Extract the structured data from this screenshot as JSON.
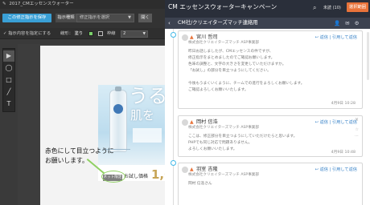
{
  "left": {
    "window_title": "2017_CMエッセンスウォーター",
    "save_button": "この修正指示を保存",
    "direction_label": "指示種類",
    "direction_placeholder": "修正指示を選択",
    "pull_button": "開く",
    "show_instructions": "指示内容を指定にする",
    "line_label": "線形：",
    "line_value": "塗り",
    "border_label": "枠線",
    "border_value": "2",
    "tools": [
      "▶",
      "◯",
      "□",
      "╱",
      "T"
    ],
    "annotation_text_1": "赤色にして目立つように",
    "annotation_text_2": "お願いします。",
    "ad": {
      "headline_1": "うる",
      "headline_2": "肌を",
      "badge": "ネット限定",
      "price_label": "お試し価格",
      "price_value": "1,0"
    }
  },
  "right": {
    "title": "CM エッセンスウォーターキャンペーン",
    "search_icon": "search-icon",
    "status": "未読 (10)",
    "select_button": "選択範囲",
    "sub_title": "CM社/クリエイターズマッチ連絡用",
    "sub_icons": "👤 ✉ ⚙",
    "messages": [
      {
        "name": "宮川 哲司",
        "company": "株式会社クリエイターズマッチ ASP事業部",
        "actions": "↩ 返信 | 引用して返信",
        "body": "昨日お話しましたが、CMエッセンスの件ですが、\n修正指示をまとめましたのでご確認お願いします。\n色味の調整と、文字の大きさを変更していただけますか。\n「お試し」の部分を目立つようにしてください。\n\n今後もうまくいくように、チームでの進行をよろしくお願いします。\nご確認よろしくお願いいたします。",
        "time": "4月9日 10:28"
      },
      {
        "name": "岡村 信浩",
        "company": "株式会社クリエイターズマッチ ASP事業部",
        "actions": "↩ 返信 | 引用して返信",
        "body": "ここは、修正部分を目立つようにしていただけたらと思います。\nPHPでも同じ対応で問題ありません。\nよろしくお願いいたします。",
        "time": "4月9日 10:48"
      },
      {
        "name": "羽室 吉隆",
        "company": "株式会社クリエイターズマッチ ASP事業部",
        "actions": "↩ 返信 | 引用して返信",
        "body": "岡村 信浩さん",
        "time": ""
      }
    ]
  }
}
